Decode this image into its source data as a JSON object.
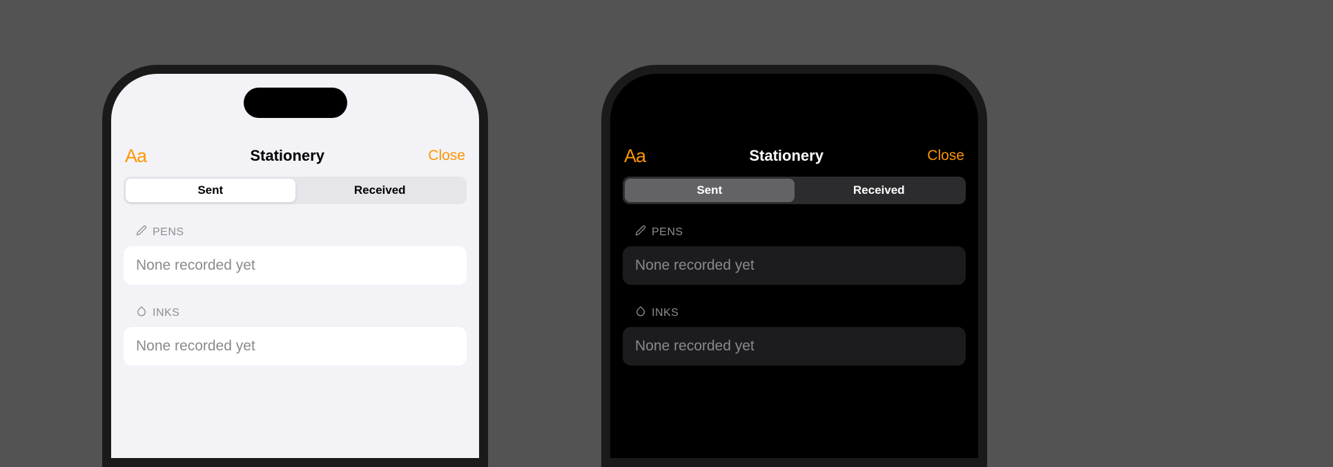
{
  "colors": {
    "accent": "#ff9500",
    "backgroundLight": "#f2f2f7",
    "backgroundDark": "#000000",
    "cardLight": "#ffffff",
    "cardDark": "#1c1c1e",
    "secondaryText": "#8e8e93"
  },
  "nav": {
    "fontButton": "Aa",
    "title": "Stationery",
    "close": "Close"
  },
  "segments": {
    "sent": "Sent",
    "received": "Received",
    "selected": "sent"
  },
  "sections": [
    {
      "icon": "pen-icon",
      "label": "PENS",
      "empty": "None recorded yet"
    },
    {
      "icon": "drop-icon",
      "label": "INKS",
      "empty": "None recorded yet"
    }
  ],
  "variants": [
    {
      "theme": "light"
    },
    {
      "theme": "dark"
    }
  ]
}
